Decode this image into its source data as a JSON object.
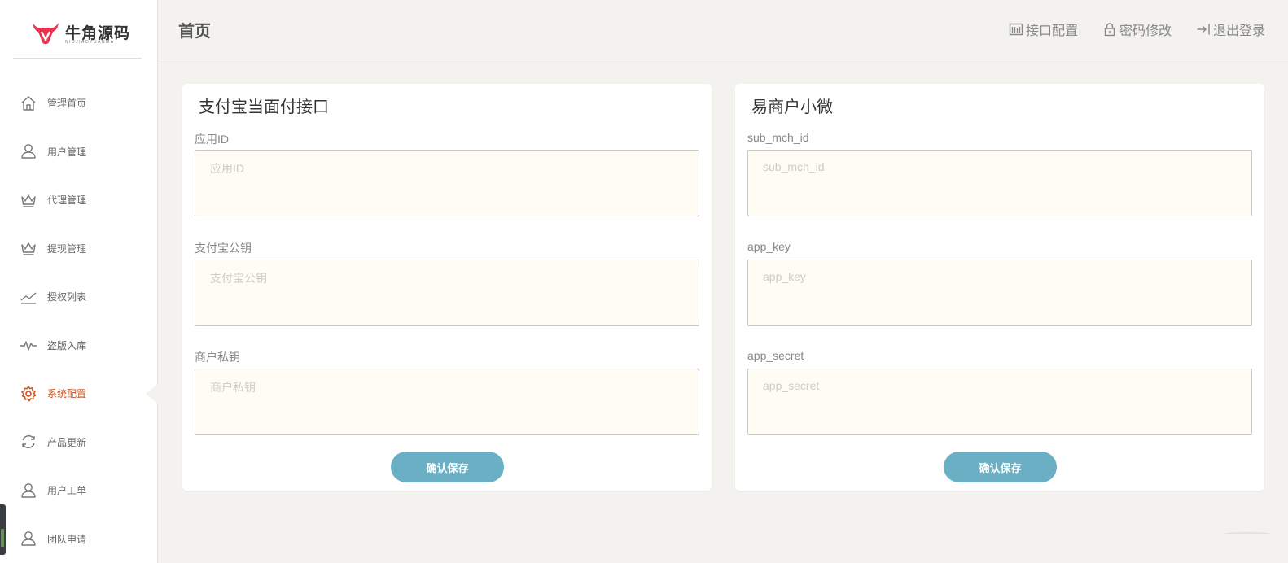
{
  "brand": {
    "name": "牛角源码",
    "subtitle": "NIUJIAOYUANMA",
    "color": "#e8324f"
  },
  "sidebar": {
    "items": [
      {
        "label": "管理首页",
        "icon": "home-icon",
        "active": false
      },
      {
        "label": "用户管理",
        "icon": "user-icon",
        "active": false
      },
      {
        "label": "代理管理",
        "icon": "crown-icon",
        "active": false
      },
      {
        "label": "提现管理",
        "icon": "crown-icon",
        "active": false
      },
      {
        "label": "授权列表",
        "icon": "trend-icon",
        "active": false
      },
      {
        "label": "盗版入库",
        "icon": "pulse-icon",
        "active": false
      },
      {
        "label": "系统配置",
        "icon": "gear-icon",
        "active": true
      },
      {
        "label": "产品更新",
        "icon": "refresh-icon",
        "active": false
      },
      {
        "label": "用户工单",
        "icon": "user-icon",
        "active": false
      },
      {
        "label": "团队申请",
        "icon": "user-icon",
        "active": false
      }
    ],
    "active_color": "#c8531f"
  },
  "header": {
    "title": "首页",
    "actions": [
      {
        "label": "接口配置",
        "icon": "config-icon"
      },
      {
        "label": "密码修改",
        "icon": "lock-icon"
      },
      {
        "label": "退出登录",
        "icon": "logout-icon"
      }
    ]
  },
  "cards": [
    {
      "title": "支付宝当面付接口",
      "fields": [
        {
          "label": "应用ID",
          "placeholder": "应用ID",
          "value": ""
        },
        {
          "label": "支付宝公钥",
          "placeholder": "支付宝公钥",
          "value": ""
        },
        {
          "label": "商户私钥",
          "placeholder": "商户私钥",
          "value": ""
        }
      ],
      "button": "确认保存"
    },
    {
      "title": "易商户小微",
      "fields": [
        {
          "label": "sub_mch_id",
          "placeholder": "sub_mch_id",
          "value": ""
        },
        {
          "label": "app_key",
          "placeholder": "app_key",
          "value": ""
        },
        {
          "label": "app_secret",
          "placeholder": "app_secret",
          "value": ""
        }
      ],
      "button": "确认保存"
    }
  ],
  "colors": {
    "button": "#6aafc4",
    "field_bg": "#fffcf4",
    "page_bg": "#f3f2ee"
  }
}
